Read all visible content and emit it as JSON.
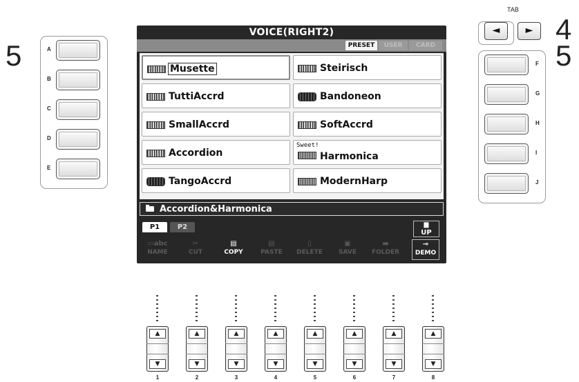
{
  "screen": {
    "title": "VOICE(RIGHT2)",
    "tabs": [
      "PRESET",
      "USER",
      "CARD"
    ],
    "voices": [
      {
        "name": "Musette",
        "tag": "",
        "icon": "accordion-icon",
        "selected": true
      },
      {
        "name": "Steirisch",
        "tag": "",
        "icon": "accordion-icon"
      },
      {
        "name": "TuttiAccrd",
        "tag": "",
        "icon": "accordion-icon"
      },
      {
        "name": "Bandoneon",
        "tag": "",
        "icon": "bandoneon-icon"
      },
      {
        "name": "SmallAccrd",
        "tag": "",
        "icon": "accordion-icon"
      },
      {
        "name": "SoftAccrd",
        "tag": "",
        "icon": "accordion-icon"
      },
      {
        "name": "Accordion",
        "tag": "",
        "icon": "accordion-icon"
      },
      {
        "name": "Harmonica",
        "tag": "Sweet!",
        "icon": "harmonica-icon"
      },
      {
        "name": "TangoAccrd",
        "tag": "",
        "icon": "bandoneon-icon"
      },
      {
        "name": "ModernHarp",
        "tag": "",
        "icon": "harmonica-icon"
      }
    ],
    "folder": "Accordion&Harmonica",
    "pages": [
      "P1",
      "P2"
    ],
    "up_label": "UP",
    "functions": [
      {
        "label": "NAME",
        "icon": "name-icon",
        "glyph": "▭abc"
      },
      {
        "label": "CUT",
        "icon": "scissors-icon",
        "glyph": "✂"
      },
      {
        "label": "COPY",
        "icon": "copy-icon",
        "glyph": "▤"
      },
      {
        "label": "PASTE",
        "icon": "paste-icon",
        "glyph": "▤"
      },
      {
        "label": "DELETE",
        "icon": "trash-icon",
        "glyph": "▯"
      },
      {
        "label": "SAVE",
        "icon": "save-icon",
        "glyph": "▣"
      },
      {
        "label": "FOLDER",
        "icon": "folder-icon",
        "glyph": "▬"
      },
      {
        "label": "DEMO",
        "icon": "trumpet-icon",
        "glyph": "⊸"
      }
    ]
  },
  "left_buttons": [
    "A",
    "B",
    "C",
    "D",
    "E"
  ],
  "right_buttons": [
    "F",
    "G",
    "H",
    "I",
    "J"
  ],
  "step_labels": {
    "left": "5",
    "right": "5",
    "tab": "4"
  },
  "tab_label": "TAB",
  "tab_arrows": {
    "left": "◄",
    "right": "►"
  },
  "dial_numbers": [
    "1",
    "2",
    "3",
    "4",
    "5",
    "6",
    "7",
    "8"
  ],
  "dial_arrows": {
    "up": "▲",
    "down": "▼"
  }
}
